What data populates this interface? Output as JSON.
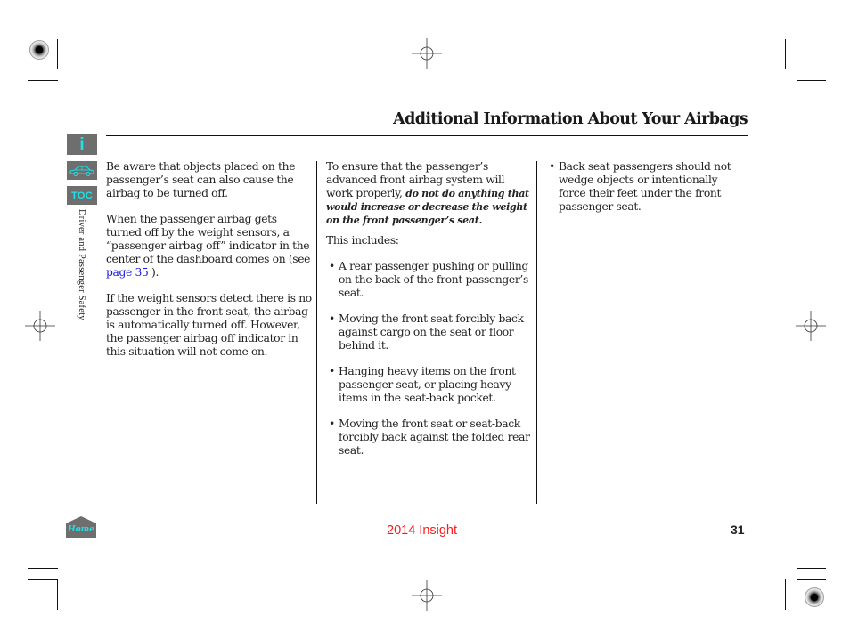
{
  "header": {
    "title": "Additional Information About Your Airbags"
  },
  "sidebar": {
    "info_label": "i",
    "toc_label": "TOC",
    "section_label": "Driver and Passenger Safety",
    "home_label": "Home",
    "icon_color": "#21e0e8",
    "button_bg": "#6e6e6e"
  },
  "column1": {
    "para1": "Be aware that objects placed on the passenger’s seat can also cause the airbag to be turned off.",
    "para2_before_link": "When the passenger airbag gets turned off by the weight sensors, a “passenger airbag off” indicator in the center of the dashboard comes on (see ",
    "para2_link": "page 35",
    "para2_after_link": " ).",
    "para3": "If the weight sensors detect there is no passenger in the front seat, the airbag is automatically turned off. However, the passenger airbag off indicator in this situation will not come on."
  },
  "column2": {
    "intro_normal": "To ensure that the passenger’s advanced front airbag system will work properly, ",
    "intro_warning": "do not do anything that would increase or decrease the weight on the front passenger’s seat.",
    "includes": "This includes:",
    "bullets": [
      "A rear passenger pushing or pulling on the back of the front passenger’s seat.",
      "Moving the front seat forcibly back against cargo on the seat or floor behind it.",
      "Hanging heavy items on the front passenger seat, or placing heavy items in the seat-back pocket.",
      "Moving the front seat or seat-back forcibly back against the folded rear seat."
    ]
  },
  "column3": {
    "bullets": [
      "Back seat passengers should not wedge objects or intentionally force their feet under the front passenger seat."
    ]
  },
  "footer": {
    "model": "2014 Insight",
    "page_number": "31",
    "model_color": "#ff1a1a",
    "link_color": "#1a1ae6"
  },
  "bullet_glyph": "•"
}
